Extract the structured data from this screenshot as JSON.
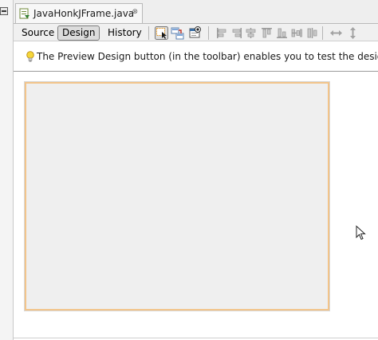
{
  "editor": {
    "file_tab": {
      "title": "JavaHonkJFrame.java",
      "close_glyph": "⊗",
      "icon": "java-file-icon"
    }
  },
  "toolbar": {
    "views": {
      "source_label": "Source",
      "design_label": "Design",
      "history_label": "History",
      "active": "Design"
    },
    "tools": [
      "selection-mode-icon",
      "connection-mode-icon",
      "preview-design-icon",
      "align-left-icon",
      "align-right-icon",
      "center-horizontally-icon",
      "align-top-icon",
      "align-bottom-icon",
      "center-vertically-icon",
      "change-horizontal-resizability-icon",
      "change-vertical-resizability-icon"
    ]
  },
  "hint": {
    "icon": "lightbulb-icon",
    "text": "The Preview Design button (in the toolbar) enables you to test the design of the"
  },
  "colors": {
    "frame_border": "#f2c48a",
    "canvas_background": "#efefef",
    "toolbar_background": "#f0f0f0"
  }
}
